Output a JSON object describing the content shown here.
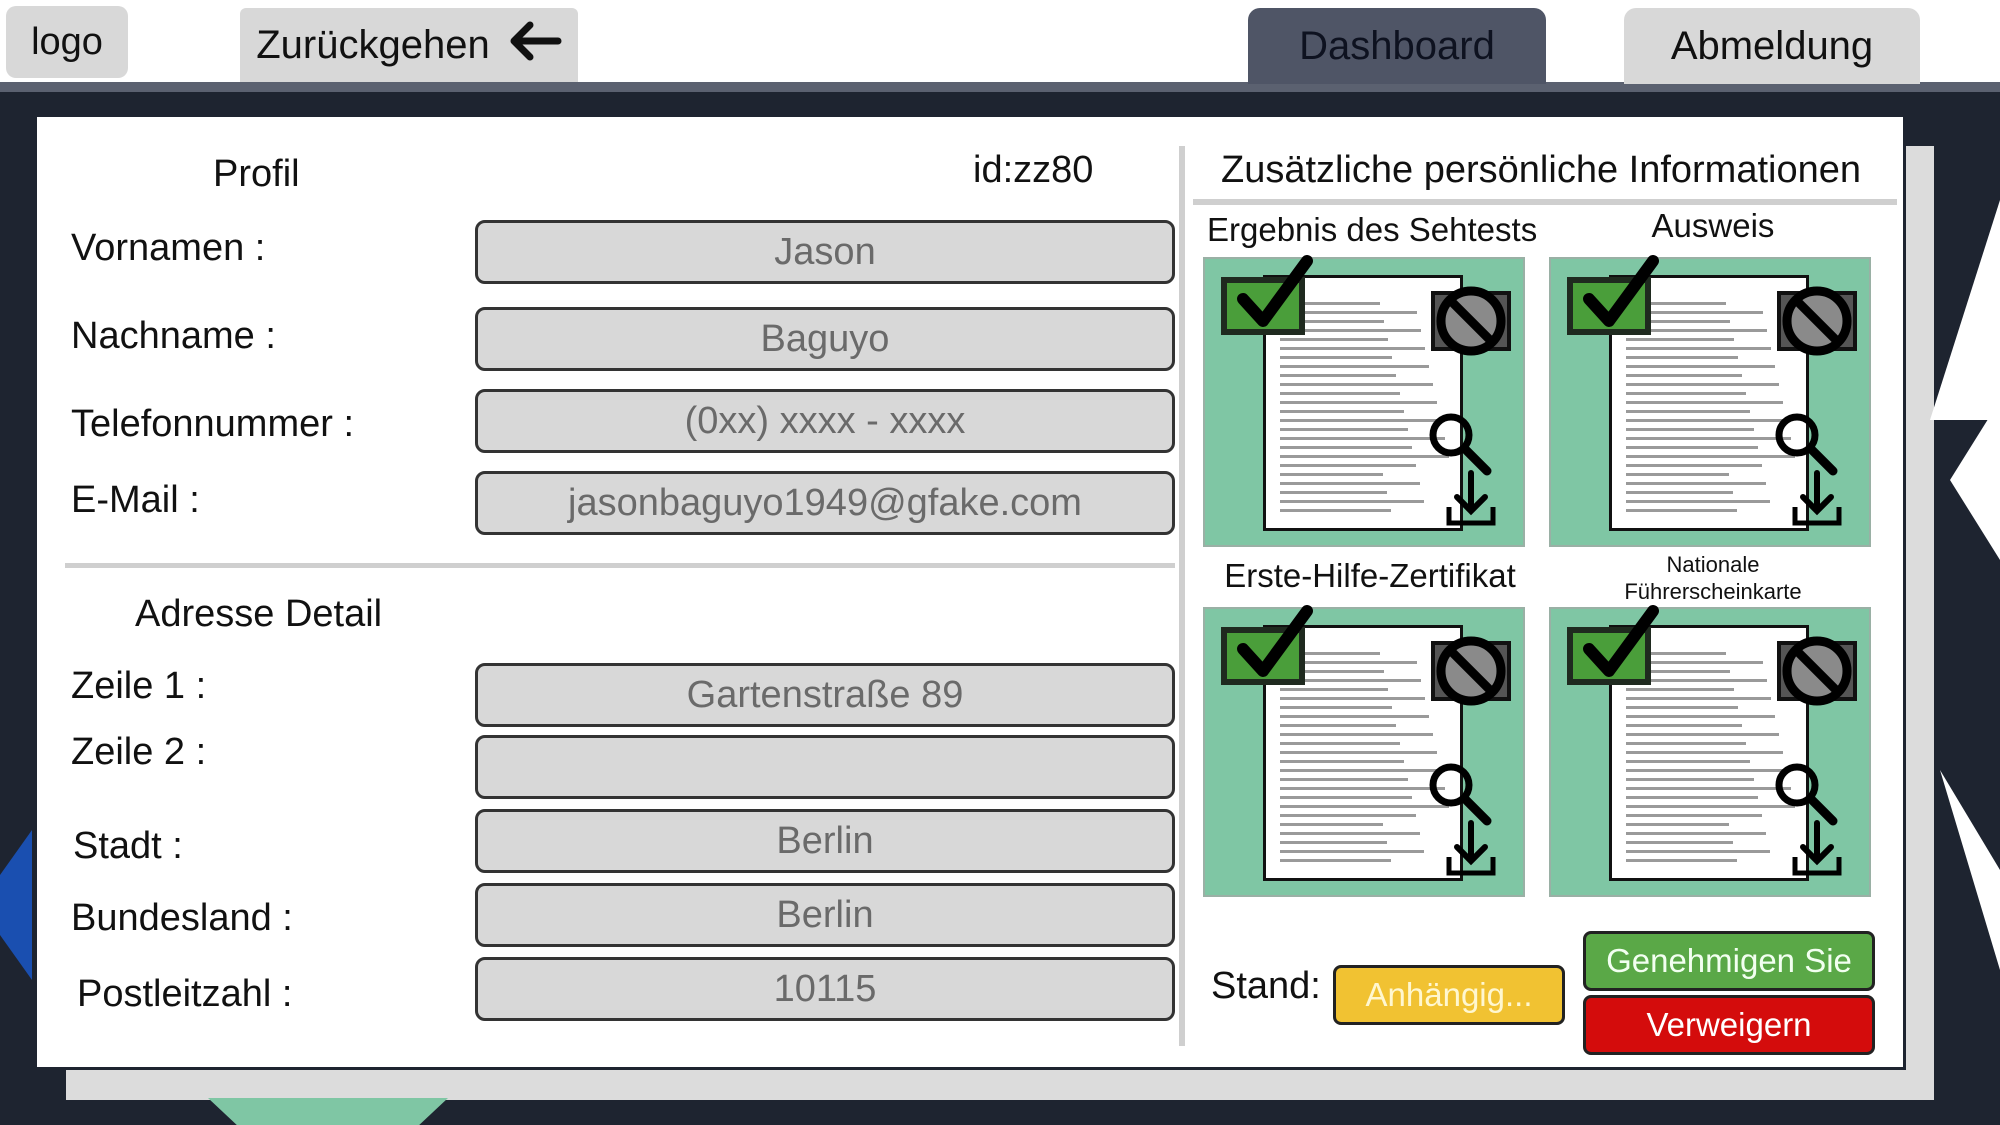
{
  "header": {
    "logo": "logo",
    "back_label": "Zurückgehen",
    "back_icon": "arrow-left-icon",
    "dashboard_label": "Dashboard",
    "logout_label": "Abmeldung"
  },
  "profile": {
    "title": "Profil",
    "id": "id:zz80",
    "fields": [
      {
        "label": "Vornamen :",
        "value": "Jason"
      },
      {
        "label": "Nachname :",
        "value": "Baguyo"
      },
      {
        "label": "Telefonnummer :",
        "value": "(0xx) xxxx - xxxx"
      },
      {
        "label": "E-Mail :",
        "value": "jasonbaguyo1949@gfake.com"
      }
    ]
  },
  "address": {
    "title": "Adresse Detail",
    "fields": [
      {
        "label": "Zeile 1 :",
        "value": "Gartenstraße 89"
      },
      {
        "label": "Zeile 2 :",
        "value": ""
      },
      {
        "label": "Stadt :",
        "value": "Berlin"
      },
      {
        "label": "Bundesland :",
        "value": "Berlin"
      },
      {
        "label": "Postleitzahl :",
        "value": "10115"
      }
    ]
  },
  "additional": {
    "title": "Zusätzliche persönliche Informationen",
    "documents": [
      {
        "title": "Ergebnis des Sehtests"
      },
      {
        "title": "Ausweis"
      },
      {
        "title": "Erste-Hilfe-Zertifikat"
      },
      {
        "title": "Nationale\nFührerscheinkarte"
      }
    ],
    "icons": [
      "check-icon",
      "block-icon",
      "zoom-icon",
      "download-icon"
    ]
  },
  "status": {
    "label": "Stand:",
    "value": "Anhängig...",
    "approve_label": "Genehmigen Sie",
    "deny_label": "Verweigern"
  },
  "colors": {
    "dark_background": "#1e2430",
    "doc_card": "#7fc6a4",
    "pending": "#f1c232",
    "approve": "#5aa847",
    "deny": "#d40c0c"
  }
}
